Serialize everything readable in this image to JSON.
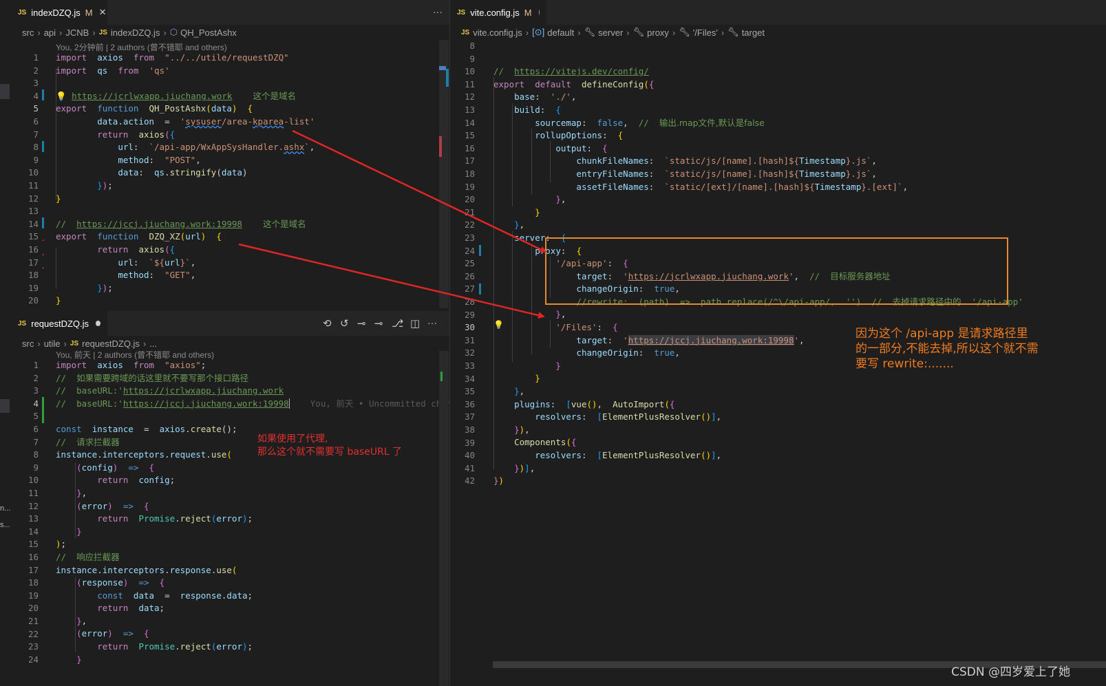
{
  "top_pane": {
    "tab": {
      "icon": "JS",
      "title": "indexDZQ.js",
      "status": "M"
    },
    "more": "···",
    "breadcrumb": [
      "src",
      "api",
      "JCNB",
      "indexDZQ.js",
      "QH_PostAshx"
    ],
    "codelens": "You, 2分钟前 | 2 authors (曾不错耶 and others)",
    "line_numbers": [
      "1",
      "2",
      "3",
      "4",
      "5",
      "6",
      "7",
      "8",
      "9",
      "10",
      "11",
      "12",
      "13",
      "14",
      "15",
      "16",
      "17",
      "18",
      "19",
      "20"
    ]
  },
  "bottom_pane": {
    "tab": {
      "icon": "JS",
      "title": "requestDZQ.js"
    },
    "breadcrumb": [
      "src",
      "utile",
      "requestDZQ.js",
      "..."
    ],
    "codelens": "You, 前天 | 2 authors (曾不错耶 and others)",
    "line_numbers": [
      "1",
      "2",
      "3",
      "4",
      "5",
      "6",
      "7",
      "8",
      "9",
      "10",
      "11",
      "12",
      "13",
      "14",
      "15",
      "16",
      "17",
      "18",
      "19",
      "20",
      "21",
      "22",
      "23",
      "24"
    ],
    "blame": "You, 前天 • Uncommitted changes"
  },
  "right_pane": {
    "tab": {
      "icon": "JS",
      "title": "vite.config.js",
      "status": "M"
    },
    "breadcrumb": [
      "vite.config.js",
      "default",
      "server",
      "proxy",
      "'/Files'",
      "target"
    ],
    "line_numbers": [
      "8",
      "9",
      "10",
      "11",
      "12",
      "13",
      "14",
      "15",
      "16",
      "17",
      "18",
      "19",
      "20",
      "21",
      "22",
      "23",
      "24",
      "25",
      "26",
      "27",
      "28",
      "29",
      "30",
      "31",
      "32",
      "33",
      "34",
      "35",
      "36",
      "37",
      "38",
      "39",
      "40",
      "41",
      "42"
    ]
  },
  "annotations": {
    "proxy_note": [
      "如果使用了代理,",
      "那么这个就不需要写 baseURL 了"
    ],
    "rewrite_note": [
      "因为这个 /api-app 是请求路径里",
      "的一部分,不能去掉,所以这个就不需",
      "要写 rewrite:......."
    ]
  },
  "watermark": "CSDN @四岁爱上了她",
  "colors": {
    "arrow": "#e02525",
    "highlight_box": "#e8892b",
    "annotation_red": "#e03030",
    "annotation_orange": "#f07b20"
  }
}
